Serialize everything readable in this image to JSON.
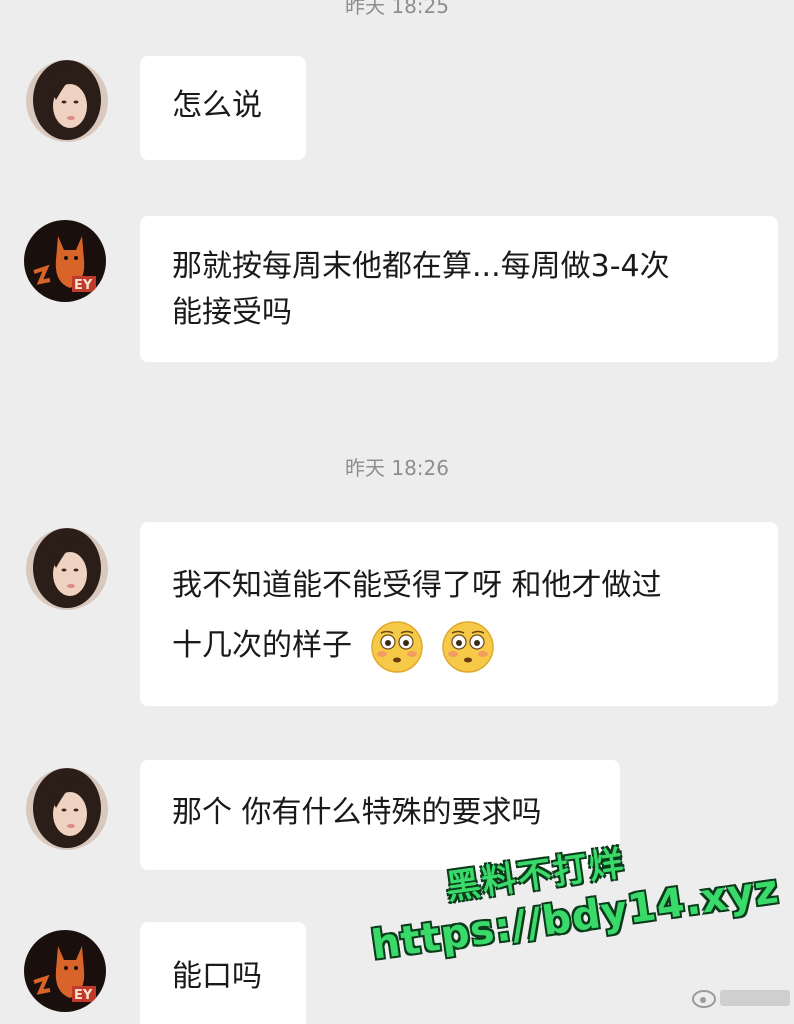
{
  "chat": {
    "timestamp_top_cut": "昨天 18:25",
    "timestamp_mid": "昨天 18:26",
    "messages": [
      {
        "sender": "her",
        "lines": [
          "怎么说"
        ]
      },
      {
        "sender": "him",
        "lines": [
          "那就按每周末他都在算...每周做3-4次",
          "能接受吗"
        ]
      },
      {
        "sender": "her",
        "lines": [
          "我不知道能不能受得了呀 和他才做过",
          "十几次的样子"
        ],
        "emojis": [
          "flushed-face-icon",
          "flushed-face-icon"
        ]
      },
      {
        "sender": "her",
        "lines": [
          "那个 你有什么特殊的要求吗"
        ]
      },
      {
        "sender": "him",
        "lines": [
          "能口吗"
        ]
      }
    ]
  },
  "watermark": {
    "line1": "黑料不打烊",
    "line2": "https://bdy14.xyz"
  },
  "colors": {
    "background": "#ededed",
    "bubble": "#ffffff",
    "watermark_green": "#39d96a",
    "timestamp": "#8e8e8e"
  }
}
